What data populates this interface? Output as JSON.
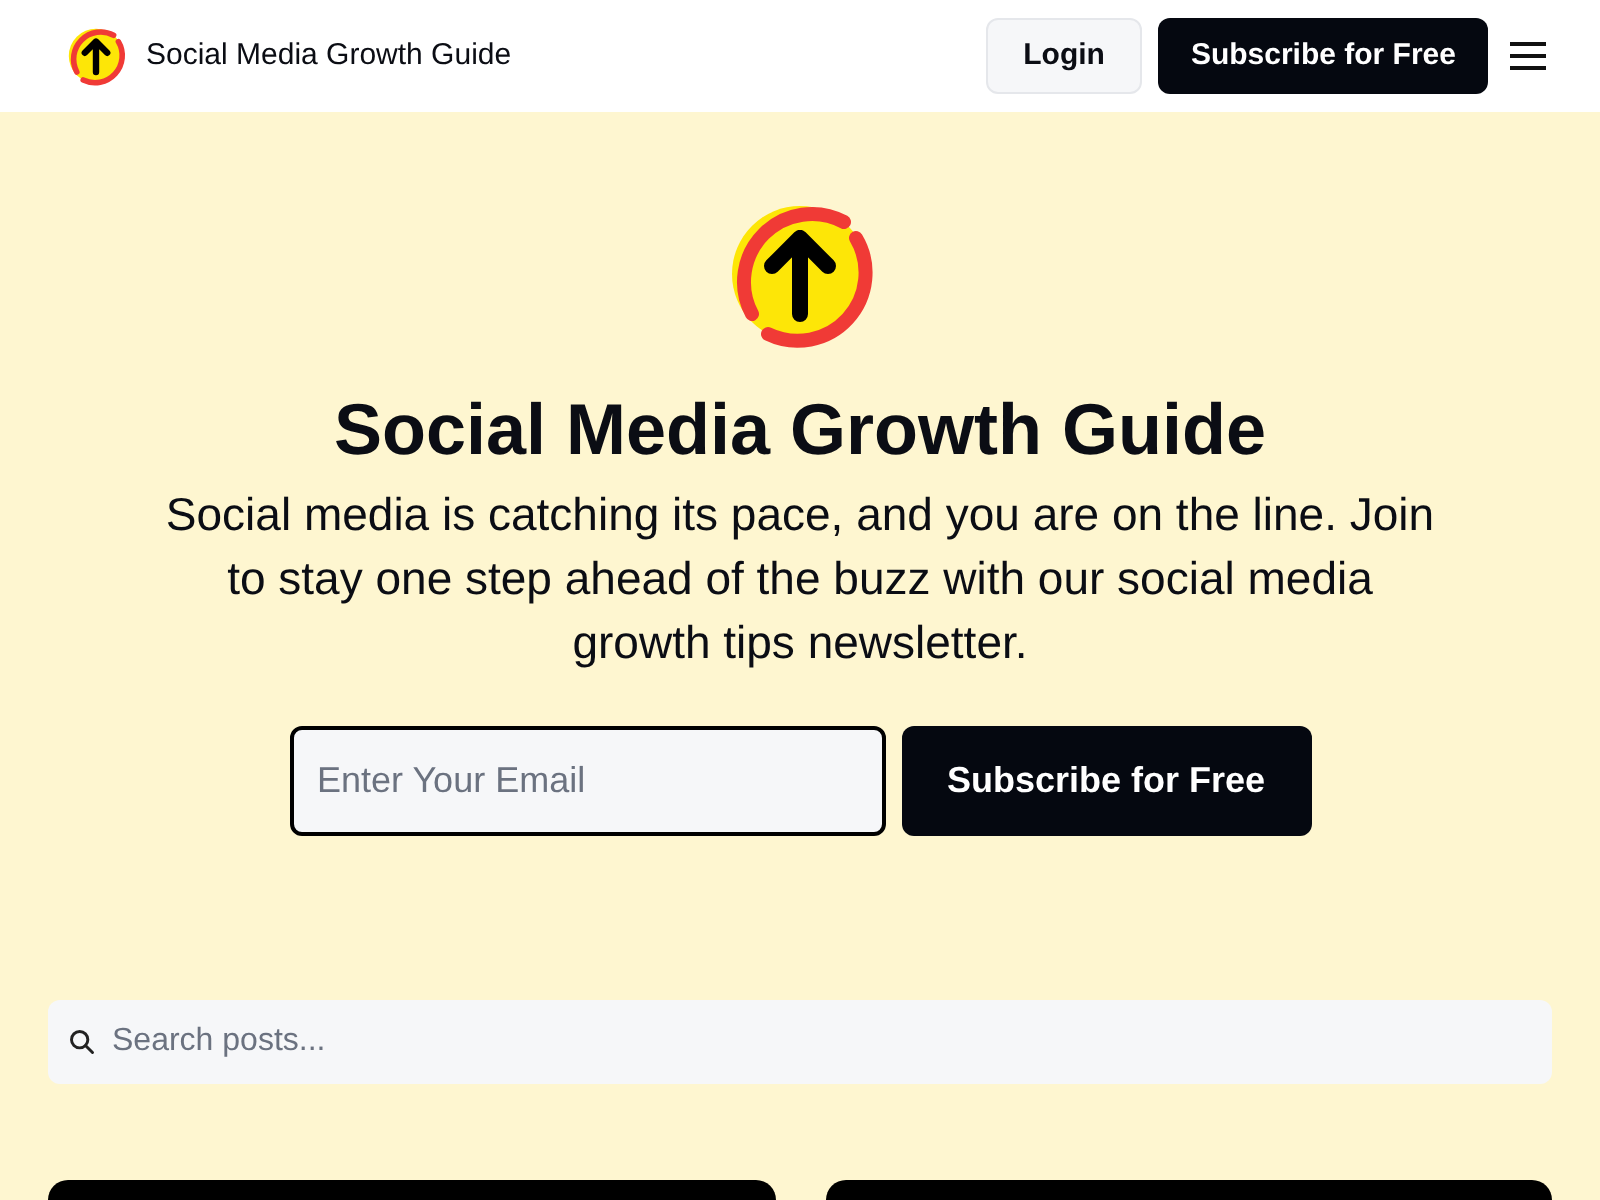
{
  "header": {
    "site_name": "Social Media Growth Guide",
    "login": "Login",
    "subscribe": "Subscribe for Free"
  },
  "hero": {
    "title": "Social Media Growth Guide",
    "description": "Social media is catching its pace, and you are on the line. Join to stay one step ahead of the buzz with our social media growth tips newsletter.",
    "email": {
      "placeholder": "Enter Your Email"
    },
    "subscribe": "Subscribe for Free"
  },
  "search": {
    "placeholder": "Search posts..."
  }
}
